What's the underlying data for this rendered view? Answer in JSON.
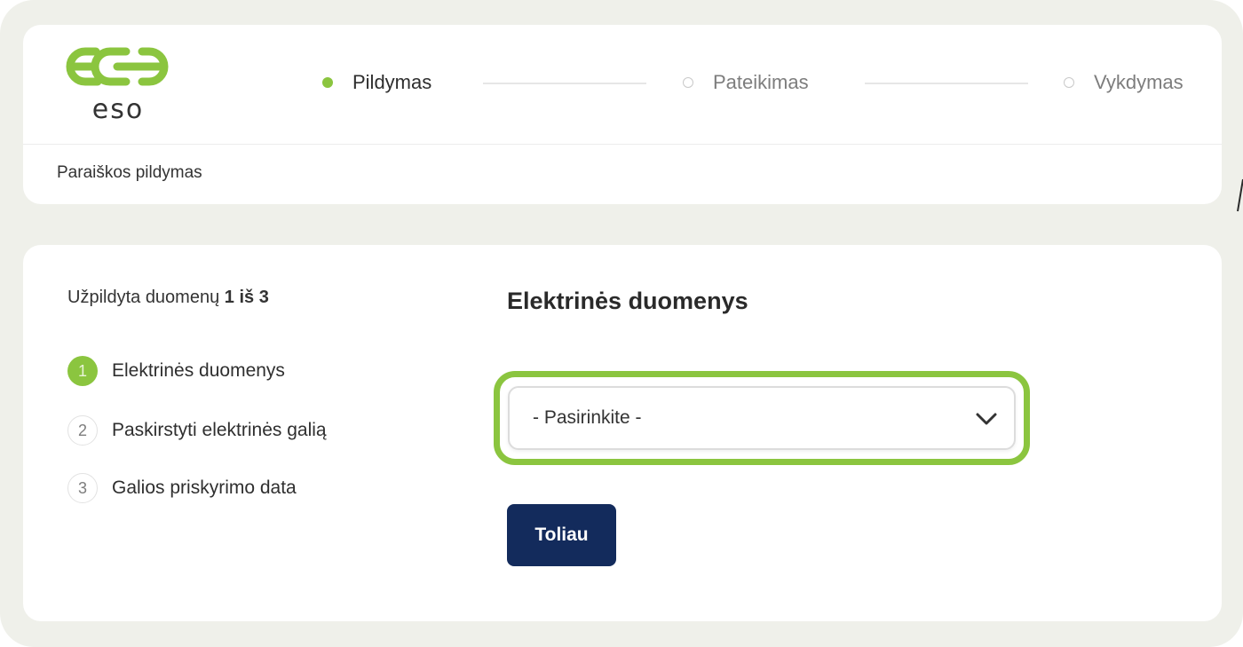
{
  "header": {
    "logo_text": "eso",
    "steps": [
      {
        "label": "Pildymas",
        "state": "active"
      },
      {
        "label": "Pateikimas",
        "state": "inactive"
      },
      {
        "label": "Vykdymas",
        "state": "inactive"
      }
    ]
  },
  "subheader": {
    "title": "Paraiškos pildymas"
  },
  "progress": {
    "prefix": "Užpildyta duomenų",
    "count": "1 iš 3"
  },
  "sidebar": {
    "steps": [
      {
        "number": "1",
        "label": "Elektrinės duomenys",
        "state": "active"
      },
      {
        "number": "2",
        "label": "Paskirstyti elektrinės galią",
        "state": "inactive"
      },
      {
        "number": "3",
        "label": "Galios priskyrimo data",
        "state": "inactive"
      }
    ]
  },
  "form": {
    "title": "Elektrinės duomenys",
    "select_value": "- Pasirinkite -",
    "next_label": "Toliau"
  },
  "colors": {
    "brand_green": "#8bc53f",
    "button_navy": "#132b5c",
    "frame_bg": "#eff0ea"
  },
  "icons": {
    "logo": "eso-logo-icon",
    "dropdown": "chevron-down-icon"
  }
}
